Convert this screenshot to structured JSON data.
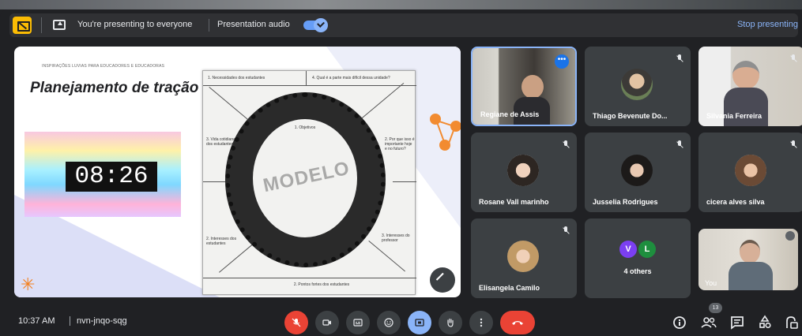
{
  "presenting_bar": {
    "status_label": "You're presenting to everyone",
    "audio_label": "Presentation audio",
    "audio_enabled": true,
    "stop_label": "Stop presenting"
  },
  "slide": {
    "supertitle": "INSPIRAÇÕES LUVIAS PARA EDUCADORES E EDUCADORAS",
    "title": "Planejamento de tração",
    "timer": "08:26",
    "watermark": "MODELO",
    "doc_cells": {
      "top_left": "1. Necessidades dos estudantes",
      "top_right": "4. Qual é a parte mais difícil dessa unidade?",
      "left_mid": "3. Vida cotidiana dos estudantes",
      "right_mid": "2. Por que isso é importante hoje e no futuro?",
      "left_low": "2. Interesses dos estudantes",
      "right_low": "3. Interesses do professor",
      "bottom": "2. Pontos fortes dos estudantes",
      "center": "1. Objetivos"
    }
  },
  "participants": [
    {
      "name": "Regiane de Assis",
      "muted": false,
      "active": true
    },
    {
      "name": "Thiago Bevenute Do...",
      "muted": true
    },
    {
      "name": "Silvania Ferreira",
      "muted": true
    },
    {
      "name": "Rosane Vall marinho",
      "muted": true
    },
    {
      "name": "Jusselia Rodrigues",
      "muted": true
    },
    {
      "name": "cicera alves silva",
      "muted": true
    },
    {
      "name": "Elisangela Camilo",
      "muted": true
    },
    {
      "name": "4 others",
      "initials": [
        "V",
        "L"
      ],
      "colors": [
        "#7b3ff2",
        "#1e8e3e"
      ]
    },
    {
      "name": "You",
      "muted": false
    }
  ],
  "meeting": {
    "time": "10:37 AM",
    "code": "nvn-jnqo-sqg",
    "participant_count": "13"
  },
  "controls": [
    "mic-off-icon",
    "camera-icon",
    "captions-icon",
    "emoji-icon",
    "present-icon",
    "raise-hand-icon",
    "more-options-icon",
    "end-call-icon"
  ],
  "right_controls": [
    "info-icon",
    "people-icon",
    "chat-icon",
    "activities-icon",
    "host-controls-icon"
  ],
  "colors": {
    "accent": "#8ab4f8",
    "danger": "#ea4335",
    "warning": "#fbbc04"
  }
}
